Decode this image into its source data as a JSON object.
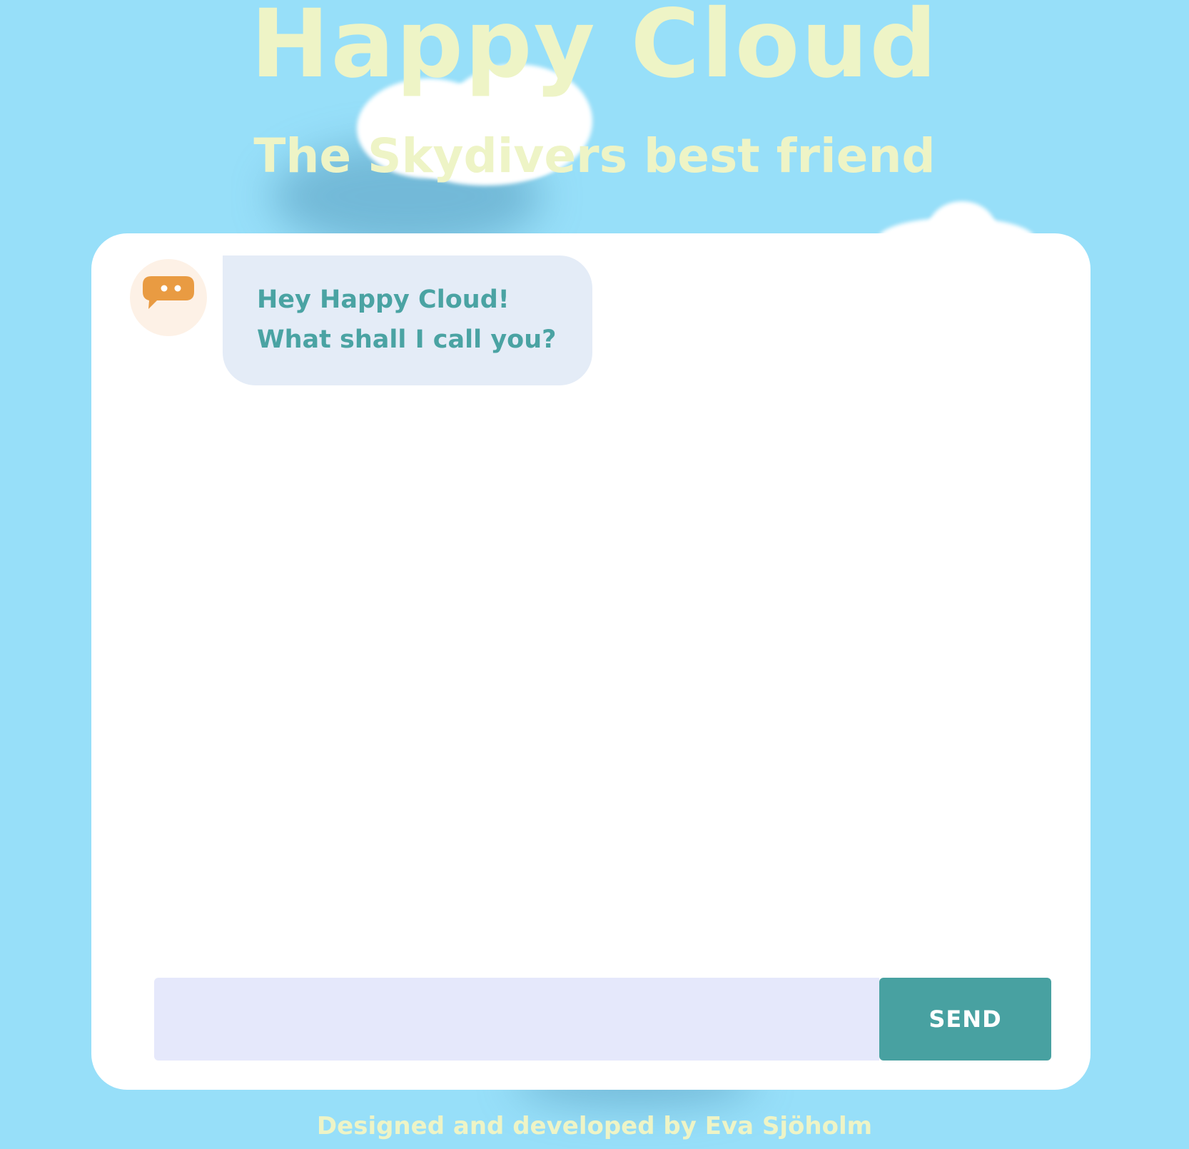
{
  "header": {
    "title": "Happy Cloud",
    "subtitle": "The Skydivers best friend"
  },
  "chat": {
    "messages": [
      {
        "sender": "bot",
        "text": "Hey Happy Cloud! What shall I call you?"
      }
    ],
    "input": {
      "value": "",
      "placeholder": ""
    },
    "send_label": "SEND"
  },
  "footer": {
    "credit": "Designed and developed by Eva Sjöholm"
  },
  "icons": {
    "bot_avatar": "chat-bubble-icon"
  },
  "colors": {
    "background": "#97dff9",
    "title": "#eef4c6",
    "bubble_background": "#e4ecf7",
    "bubble_text": "#4aa3a3",
    "input_background": "#e5e8fb",
    "send_button": "#48a1a1",
    "avatar_icon": "#e99b42",
    "avatar_background": "#fdf1e6"
  }
}
